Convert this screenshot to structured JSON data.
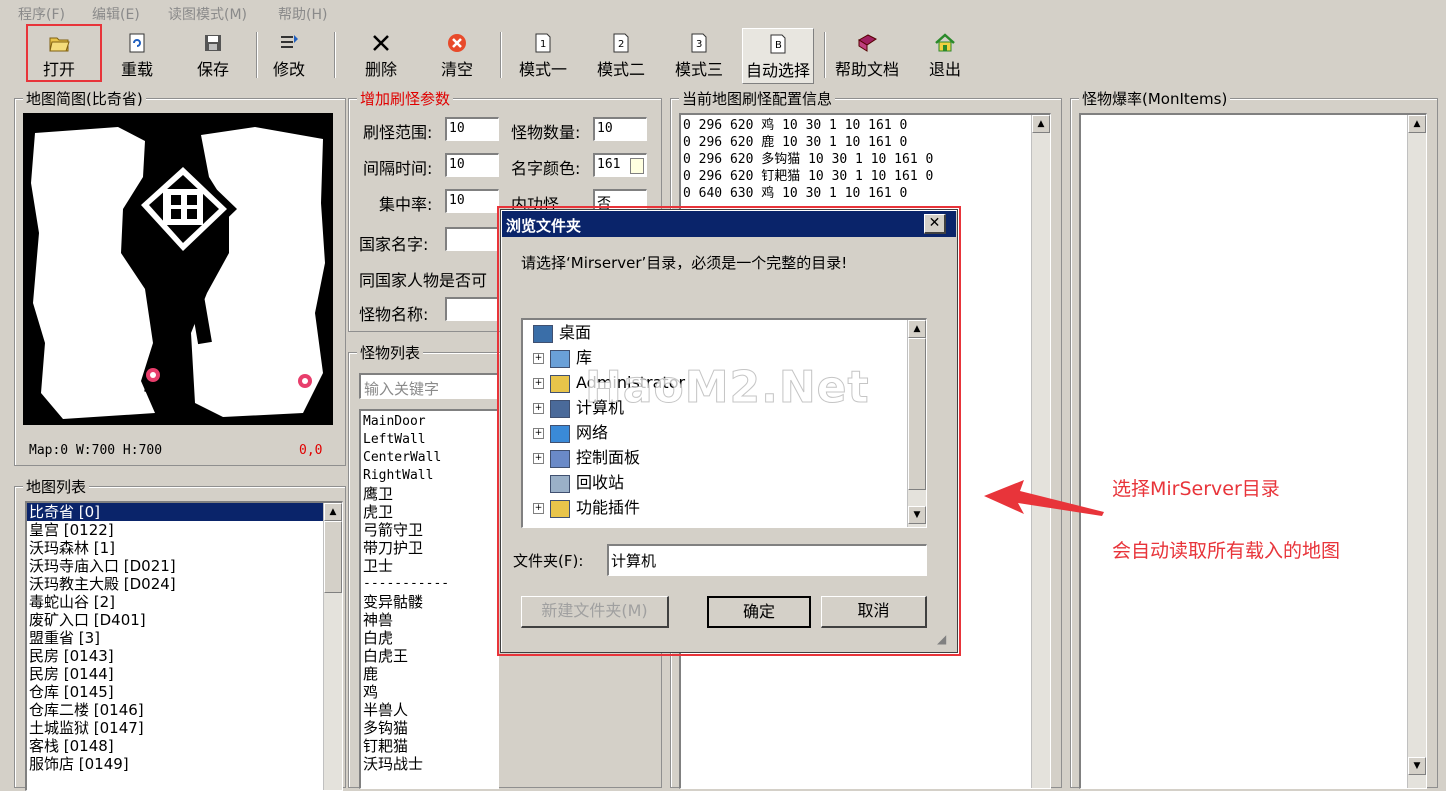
{
  "menu": [
    "程序(F)",
    "编辑(E)",
    "读图模式(M)",
    "帮助(H)"
  ],
  "toolbar": [
    {
      "label": "打开",
      "icon": "open-folder-icon"
    },
    {
      "label": "重载",
      "icon": "reload-icon"
    },
    {
      "label": "保存",
      "icon": "save-icon"
    },
    {
      "label": "修改",
      "icon": "edit-icon"
    },
    {
      "label": "删除",
      "icon": "delete-x-icon"
    },
    {
      "label": "清空",
      "icon": "clear-icon"
    },
    {
      "label": "模式一",
      "icon": "mode-1-icon",
      "num": "1"
    },
    {
      "label": "模式二",
      "icon": "mode-2-icon",
      "num": "2"
    },
    {
      "label": "模式三",
      "icon": "mode-3-icon",
      "num": "3"
    },
    {
      "label": "自动选择",
      "icon": "auto-select-icon",
      "num": "B"
    },
    {
      "label": "帮助文档",
      "icon": "help-book-icon"
    },
    {
      "label": "退出",
      "icon": "exit-home-icon"
    }
  ],
  "map_preview": {
    "title": "地图简图(比奇省)",
    "status": "Map:0  W:700 H:700",
    "coords": "0,0"
  },
  "map_list": {
    "title": "地图列表",
    "items": [
      "比奇省 [0]",
      "皇宫 [0122]",
      "沃玛森林 [1]",
      "沃玛寺庙入口 [D021]",
      "沃玛教主大殿 [D024]",
      "毒蛇山谷 [2]",
      "废矿入口 [D401]",
      "盟重省 [3]",
      "民房 [0143]",
      "民房 [0144]",
      "仓库 [0145]",
      "仓库二楼 [0146]",
      "土城监狱 [0147]",
      "客栈 [0148]",
      "服饰店 [0149]"
    ]
  },
  "params": {
    "title": "增加刷怪参数",
    "range_label": "刷怪范围:",
    "range_value": "10",
    "count_label": "怪物数量:",
    "count_value": "10",
    "interval_label": "间隔时间:",
    "interval_value": "10",
    "color_label": "名字颜色:",
    "color_value": "161",
    "focus_label": "集中率:",
    "focus_value": "10",
    "inner_label": "内功怪",
    "inner_value": "否",
    "nation_label": "国家名字:",
    "same_nation_label": "同国家人物是否可",
    "monster_name_label": "怪物名称:"
  },
  "monster_list": {
    "title": "怪物列表",
    "search_placeholder": "输入关键字",
    "items": [
      "MainDoor",
      "LeftWall",
      "CenterWall",
      "RightWall",
      "鹰卫",
      "虎卫",
      "弓箭守卫",
      "带刀护卫",
      "卫士",
      "-----------",
      "变异骷髅",
      "神兽",
      "白虎",
      "白虎王",
      "鹿",
      "鸡",
      "半兽人",
      "多钩猫",
      "钉耙猫",
      "沃玛战士"
    ]
  },
  "config": {
    "title": "当前地图刷怪配置信息",
    "lines": [
      "0 296 620 鸡 10 30 1 10 161 0",
      "0 296 620 鹿 10 30 1 10 161 0",
      "0 296 620 多钩猫 10 30 1 10 161 0",
      "0 296 620 钉耙猫 10 30 1 10 161 0",
      "0 640 630 鸡 10 30 1 10 161 0"
    ]
  },
  "drop": {
    "title": "怪物爆率(MonItems)"
  },
  "dialog": {
    "title": "浏览文件夹",
    "prompt": "请选择‘Mirserver’目录，必须是一个完整的目录!",
    "tree": [
      {
        "label": "桌面",
        "expand": false,
        "icon": "desktop-icon"
      },
      {
        "label": "库",
        "expand": true,
        "icon": "library-icon"
      },
      {
        "label": "Administrator",
        "expand": true,
        "icon": "user-folder-icon"
      },
      {
        "label": "计算机",
        "expand": true,
        "icon": "computer-icon"
      },
      {
        "label": "网络",
        "expand": true,
        "icon": "network-icon"
      },
      {
        "label": "控制面板",
        "expand": true,
        "icon": "control-panel-icon"
      },
      {
        "label": "回收站",
        "expand": false,
        "icon": "recycle-bin-icon"
      },
      {
        "label": "功能插件",
        "expand": true,
        "icon": "folder-icon"
      }
    ],
    "folder_label": "文件夹(F):",
    "folder_value": "计算机",
    "new_folder": "新建文件夹(M)",
    "ok": "确定",
    "cancel": "取消"
  },
  "watermark": "HaoM2.Net",
  "annotation": {
    "line1": "选择MirServer目录",
    "line2": "会自动读取所有载入的地图",
    "color": "#e8343a"
  }
}
